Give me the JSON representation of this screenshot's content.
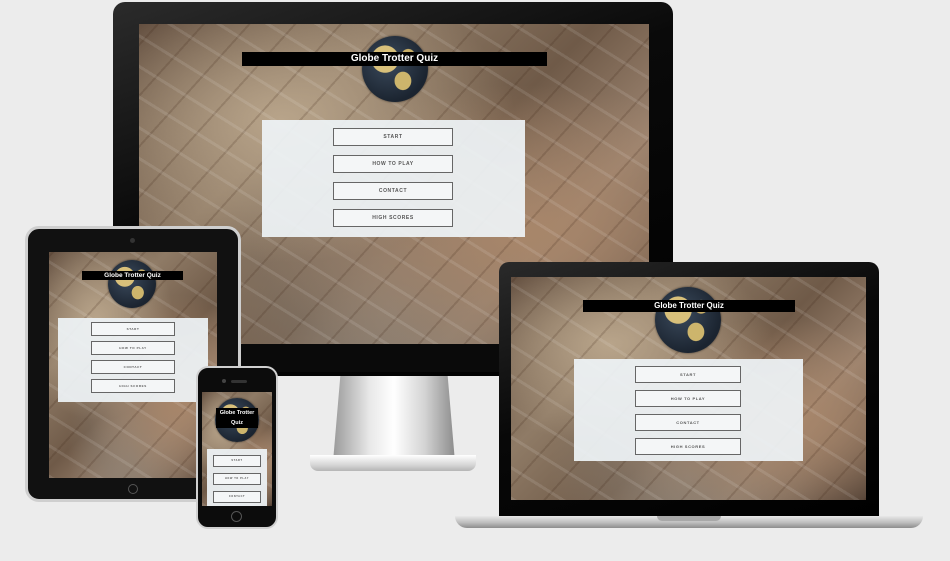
{
  "app": {
    "title": "Globe Trotter Quiz",
    "title_phone_line1": "Globe Trotter",
    "title_phone_line2": "Quiz"
  },
  "menu": {
    "start": "START",
    "how_to_play": "HOW TO PLAY",
    "contact": "CONTACT",
    "high_scores": "HIGH SCORES"
  },
  "colors": {
    "background": "#ececec",
    "device_bezel": "#0d0d0d",
    "title_bar": "#000000",
    "panel": "#eef3f6",
    "button_border": "#666666"
  }
}
